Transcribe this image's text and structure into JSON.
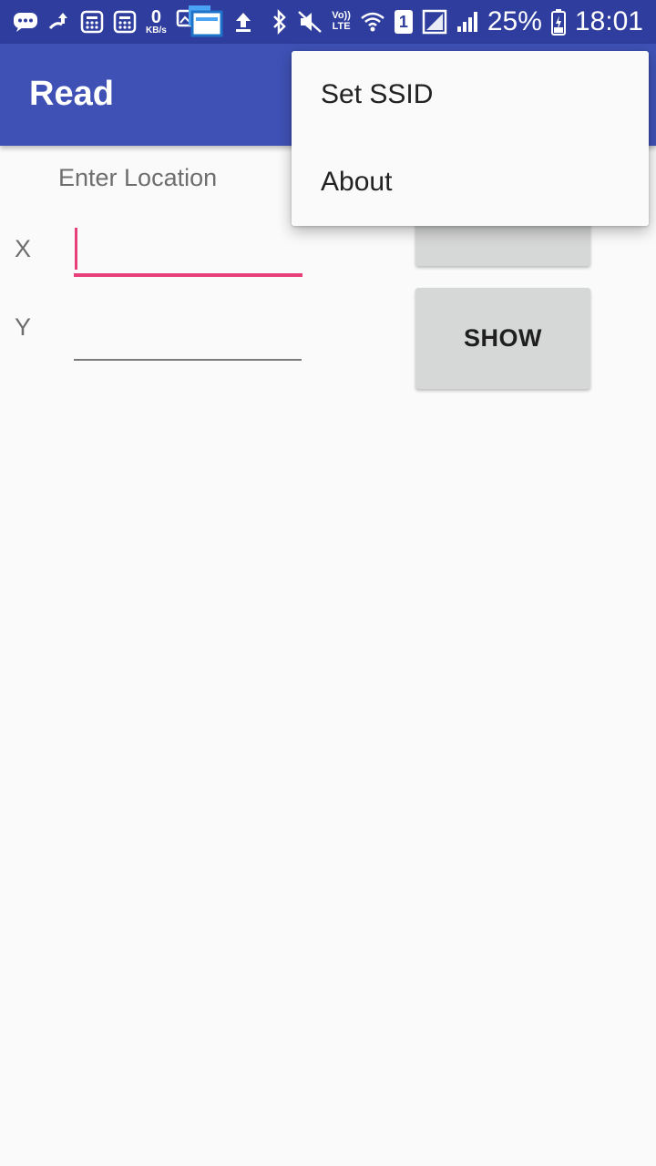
{
  "status_bar": {
    "kbs_value": "0",
    "kbs_unit": "KB/s",
    "volte_top": "Vo))",
    "volte_bottom": "LTE",
    "sim_number": "1",
    "battery_percent": "25%",
    "time": "18:01",
    "icons_left": [
      "message-icon",
      "upload-transfer-icon",
      "calculator-icon",
      "calculator-icon",
      "data-speed-indicator",
      "gallery-icon",
      "multi-window-icon",
      "upload-icon"
    ],
    "icons_right": [
      "bluetooth-icon",
      "mute-icon",
      "volte-indicator",
      "wifi-icon",
      "sim-icon",
      "signal-icon",
      "signal-icon",
      "battery-icon"
    ]
  },
  "app_bar": {
    "title": "Read"
  },
  "form": {
    "heading": "Enter Location",
    "x_label": "X",
    "y_label": "Y",
    "x_value": "",
    "y_value": "",
    "show_button": "SHOW"
  },
  "menu": {
    "items": [
      {
        "label": "Set SSID"
      },
      {
        "label": "About"
      }
    ]
  },
  "colors": {
    "status_bar": "#2f3e9e",
    "app_bar": "#3f51b5",
    "accent": "#e83e7a",
    "background": "#fafafa",
    "button": "#d6d7d7"
  }
}
